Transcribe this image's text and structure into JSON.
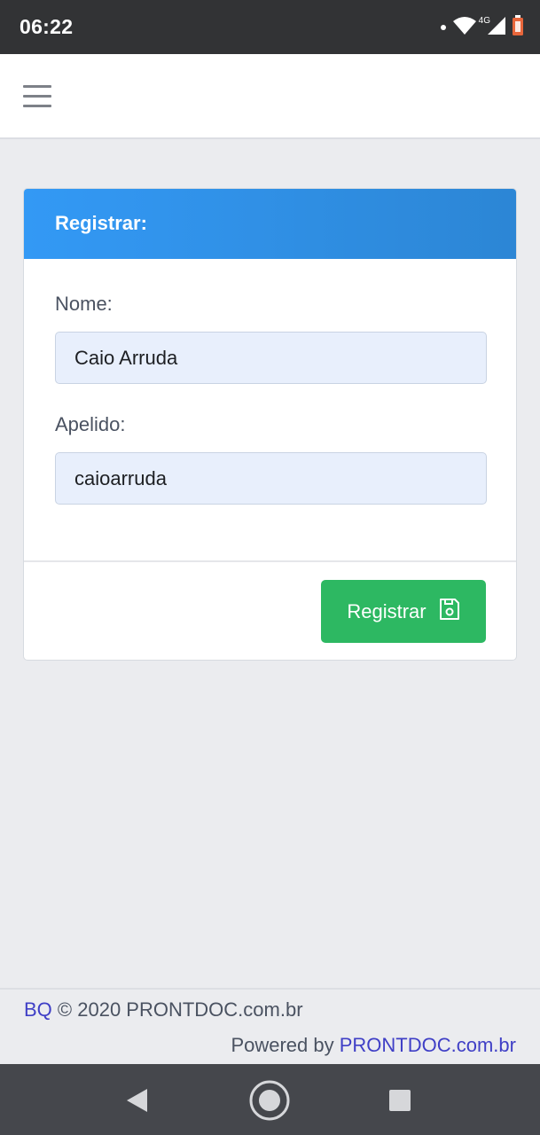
{
  "status_bar": {
    "time": "06:22",
    "network": "4G",
    "icons": [
      "notification-dot-icon",
      "wifi-icon",
      "signal-icon",
      "battery-icon"
    ]
  },
  "navbar": {
    "menu_icon": "hamburger-menu-icon"
  },
  "form": {
    "title": "Registrar:",
    "name_label": "Nome:",
    "name_value": "Caio Arruda",
    "nickname_label": "Apelido:",
    "nickname_value": "caioarruda",
    "submit_label": "Registrar",
    "submit_icon": "floppy-disk-icon"
  },
  "footer": {
    "brand_link": "BQ",
    "copyright": "© 2020 PRONTDOC.com.br",
    "powered_by": "Powered by",
    "powered_link": "PRONTDOC.com.br"
  },
  "colors": {
    "status_bar_bg": "#323335",
    "header_gradient_start": "#3399f5",
    "header_gradient_end": "#2c86d5",
    "button_green": "#2db862",
    "input_bg": "#e8effc",
    "link_color": "#3f3fc6",
    "page_bg": "#ebecef"
  }
}
